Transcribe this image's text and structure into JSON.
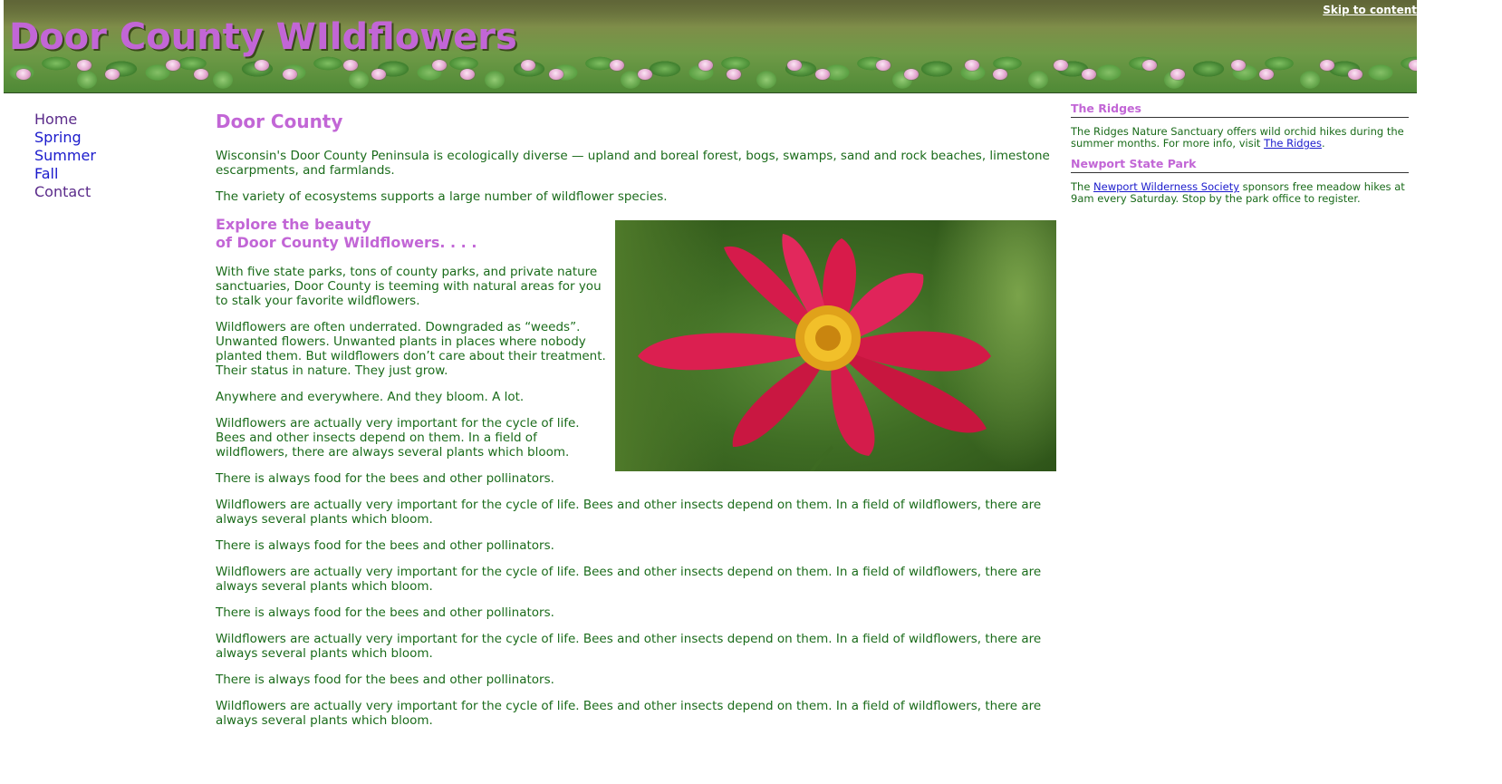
{
  "header": {
    "site_title": "Door County WIldflowers",
    "skip_link": "Skip to content"
  },
  "nav": {
    "items": [
      {
        "label": "Home"
      },
      {
        "label": "Spring"
      },
      {
        "label": "Summer"
      },
      {
        "label": "Fall"
      },
      {
        "label": "Contact"
      }
    ]
  },
  "main": {
    "title": "Door County",
    "intro": [
      "Wisconsin's Door County Peninsula is ecologically diverse — upland and boreal forest, bogs, swamps, sand and rock beaches, limestone escarpments, and farmlands.",
      "The variety of ecosystems supports a large number of wildflower species."
    ],
    "subheading_line1": "Explore the beauty",
    "subheading_line2": "of Door County Wildflowers. . . .",
    "paragraphs": [
      "With five state parks, tons of county parks, and private nature sanctuaries, Door County is teeming with natural areas for you to stalk your favorite wildflowers.",
      "Wildflowers are often underrated. Downgraded as “weeds”. Unwanted flowers. Unwanted plants in places where nobody planted them. But wildflowers don’t care about their treatment. Their status in nature. They just grow.",
      "Anywhere and everywhere. And they bloom. A lot.",
      "Wildflowers are actually very important for the cycle of life. Bees and other insects depend on them. In a field of wildflowers, there are always several plants which bloom.",
      "There is always food for the bees and other pollinators.",
      "Wildflowers are actually very important for the cycle of life. Bees and other insects depend on them. In a field of wildflowers, there are always several plants which bloom.",
      "There is always food for the bees and other pollinators.",
      "Wildflowers are actually very important for the cycle of life. Bees and other insects depend on them. In a field of wildflowers, there are always several plants which bloom.",
      "There is always food for the bees and other pollinators.",
      "Wildflowers are actually very important for the cycle of life. Bees and other insects depend on them. In a field of wildflowers, there are always several plants which bloom.",
      "There is always food for the bees and other pollinators.",
      "Wildflowers are actually very important for the cycle of life. Bees and other insects depend on them. In a field of wildflowers, there are always several plants which bloom."
    ]
  },
  "aside": {
    "ridges_heading": "The Ridges",
    "ridges_text_before": "The Ridges Nature Sanctuary offers wild orchid hikes during the summer months. For more info, visit ",
    "ridges_link": "The Ridges",
    "ridges_text_after": ".",
    "newport_heading": "Newport State Park",
    "newport_text_before": "The ",
    "newport_link": "Newport Wilderness Society",
    "newport_text_after": " sponsors free meadow hikes at 9am every Saturday. Stop by the park office to register."
  },
  "colors": {
    "heading": "#c266d6",
    "body_text": "#1a6b1a",
    "link": "#1a1acc",
    "visited_link": "#5a2a8a"
  }
}
